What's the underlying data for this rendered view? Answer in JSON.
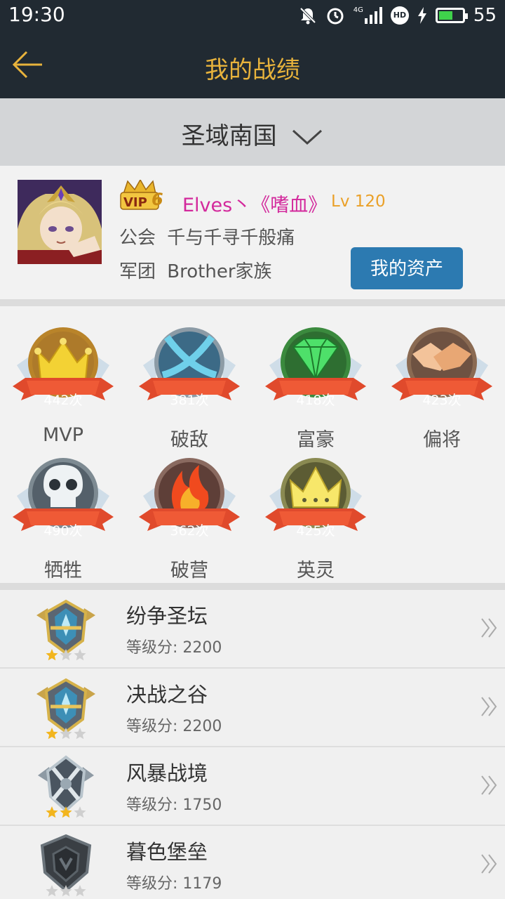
{
  "status_bar": {
    "time": "19:30",
    "network": "4G",
    "hd": "HD",
    "battery": "55",
    "battery_level": 0.55
  },
  "header": {
    "title": "我的战绩",
    "back_icon": "arrow-left-icon"
  },
  "server": {
    "name": "圣域南国",
    "dropdown_icon": "chevron-down-icon"
  },
  "profile": {
    "vip_level": "6",
    "name": "Elves丶《嗜血》",
    "level": "Lv 120",
    "guild_label": "公会",
    "guild_name": "千与千寻千般痛",
    "legion_label": "军团",
    "legion_name": "Brother家族",
    "assets_button": "我的资产"
  },
  "medals": [
    {
      "count": "442次",
      "label": "MVP",
      "icon": "crown-icon"
    },
    {
      "count": "381次",
      "label": "破敌",
      "icon": "crossed-blades-icon"
    },
    {
      "count": "418次",
      "label": "富豪",
      "icon": "diamond-icon"
    },
    {
      "count": "423次",
      "label": "偏将",
      "icon": "handshake-icon"
    },
    {
      "count": "490次",
      "label": "牺牲",
      "icon": "skull-icon"
    },
    {
      "count": "362次",
      "label": "破营",
      "icon": "flame-icon"
    },
    {
      "count": "425次",
      "label": "英灵",
      "icon": "spirit-crown-icon"
    }
  ],
  "ranks": [
    {
      "name": "纷争圣坛",
      "score": "等级分: 2200",
      "stars": 1,
      "tier": "gold"
    },
    {
      "name": "决战之谷",
      "score": "等级分: 2200",
      "stars": 1,
      "tier": "gold"
    },
    {
      "name": "风暴战境",
      "score": "等级分: 1750",
      "stars": 2,
      "tier": "silver"
    },
    {
      "name": "暮色堡垒",
      "score": "等级分: 1179",
      "stars": 0,
      "tier": "bronze"
    }
  ],
  "colors": {
    "bar_bg": "#212a32",
    "title": "#e8b33c",
    "name": "#d3299c",
    "level": "#eaa028",
    "button": "#2c7ab1",
    "ribbon": "#e04a2c"
  }
}
